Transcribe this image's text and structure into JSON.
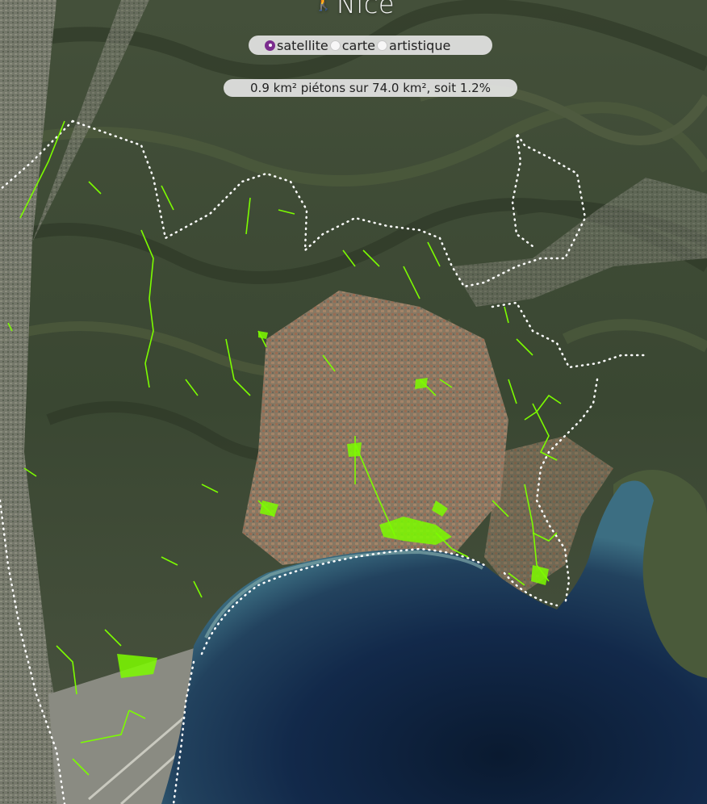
{
  "header": {
    "title": "Nice",
    "icon": "pedestrian-walking-icon"
  },
  "layers": {
    "options": [
      "satellite",
      "carte",
      "artistique"
    ],
    "selected": "satellite"
  },
  "stats": {
    "text": "0.9 km² piétons sur 74.0 km², soit 1.2%",
    "pedestrian_area_km2": 0.9,
    "total_area_km2": 74.0,
    "percent": 1.2
  },
  "colors": {
    "pedestrian_paths": "#7CFC00",
    "boundary": "#ffffff",
    "sea": "#0f2238",
    "radio_accent": "#7b2d8e"
  }
}
